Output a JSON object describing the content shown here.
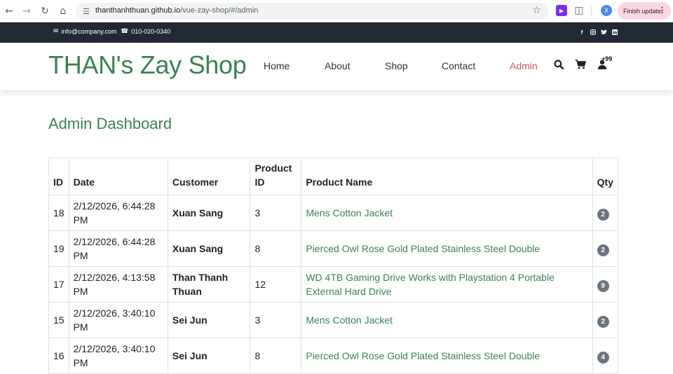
{
  "browser": {
    "url_host": "thanthanhthuan.github.io",
    "url_path": "/vue-zay-shop/#/admin",
    "profile_initial": "X",
    "update_label": "Finish update"
  },
  "topbar": {
    "email": "info@company.com",
    "phone": "010-020-0340",
    "social": [
      "facebook-icon",
      "instagram-icon",
      "twitter-icon",
      "linkedin-icon"
    ]
  },
  "brand": "THAN's Zay Shop",
  "nav": {
    "home": "Home",
    "about": "About",
    "shop": "Shop",
    "contact": "Contact",
    "admin": "Admin",
    "user_badge": "+99"
  },
  "page_title": "Admin Dashboard",
  "table": {
    "headers": {
      "id": "ID",
      "date": "Date",
      "customer": "Customer",
      "product_id": "Product ID",
      "product_name": "Product Name",
      "qty": "Qty"
    },
    "rows": [
      {
        "id": "18",
        "date": "2/12/2026, 6:44:28 PM",
        "customer": "Xuan Sang",
        "product_id": "3",
        "product_name": "Mens Cotton Jacket",
        "qty": "2"
      },
      {
        "id": "19",
        "date": "2/12/2026, 6:44:28 PM",
        "customer": "Xuan Sang",
        "product_id": "8",
        "product_name": "Pierced Owl Rose Gold Plated Stainless Steel Double",
        "qty": "2"
      },
      {
        "id": "17",
        "date": "2/12/2026, 4:13:58 PM",
        "customer": "Than Thanh Thuan",
        "product_id": "12",
        "product_name": "WD 4TB Gaming Drive Works with Playstation 4 Portable External Hard Drive",
        "qty": "9"
      },
      {
        "id": "15",
        "date": "2/12/2026, 3:40:10 PM",
        "customer": "Sei Jun",
        "product_id": "3",
        "product_name": "Mens Cotton Jacket",
        "qty": "2"
      },
      {
        "id": "16",
        "date": "2/12/2026, 3:40:10 PM",
        "customer": "Sei Jun",
        "product_id": "8",
        "product_name": "Pierced Owl Rose Gold Plated Stainless Steel Double",
        "qty": "4"
      }
    ]
  },
  "colors": {
    "brand_green": "#3c8154",
    "admin_red": "#c9575b",
    "topbar_bg": "#212934",
    "badge_gray": "#6c757d"
  }
}
